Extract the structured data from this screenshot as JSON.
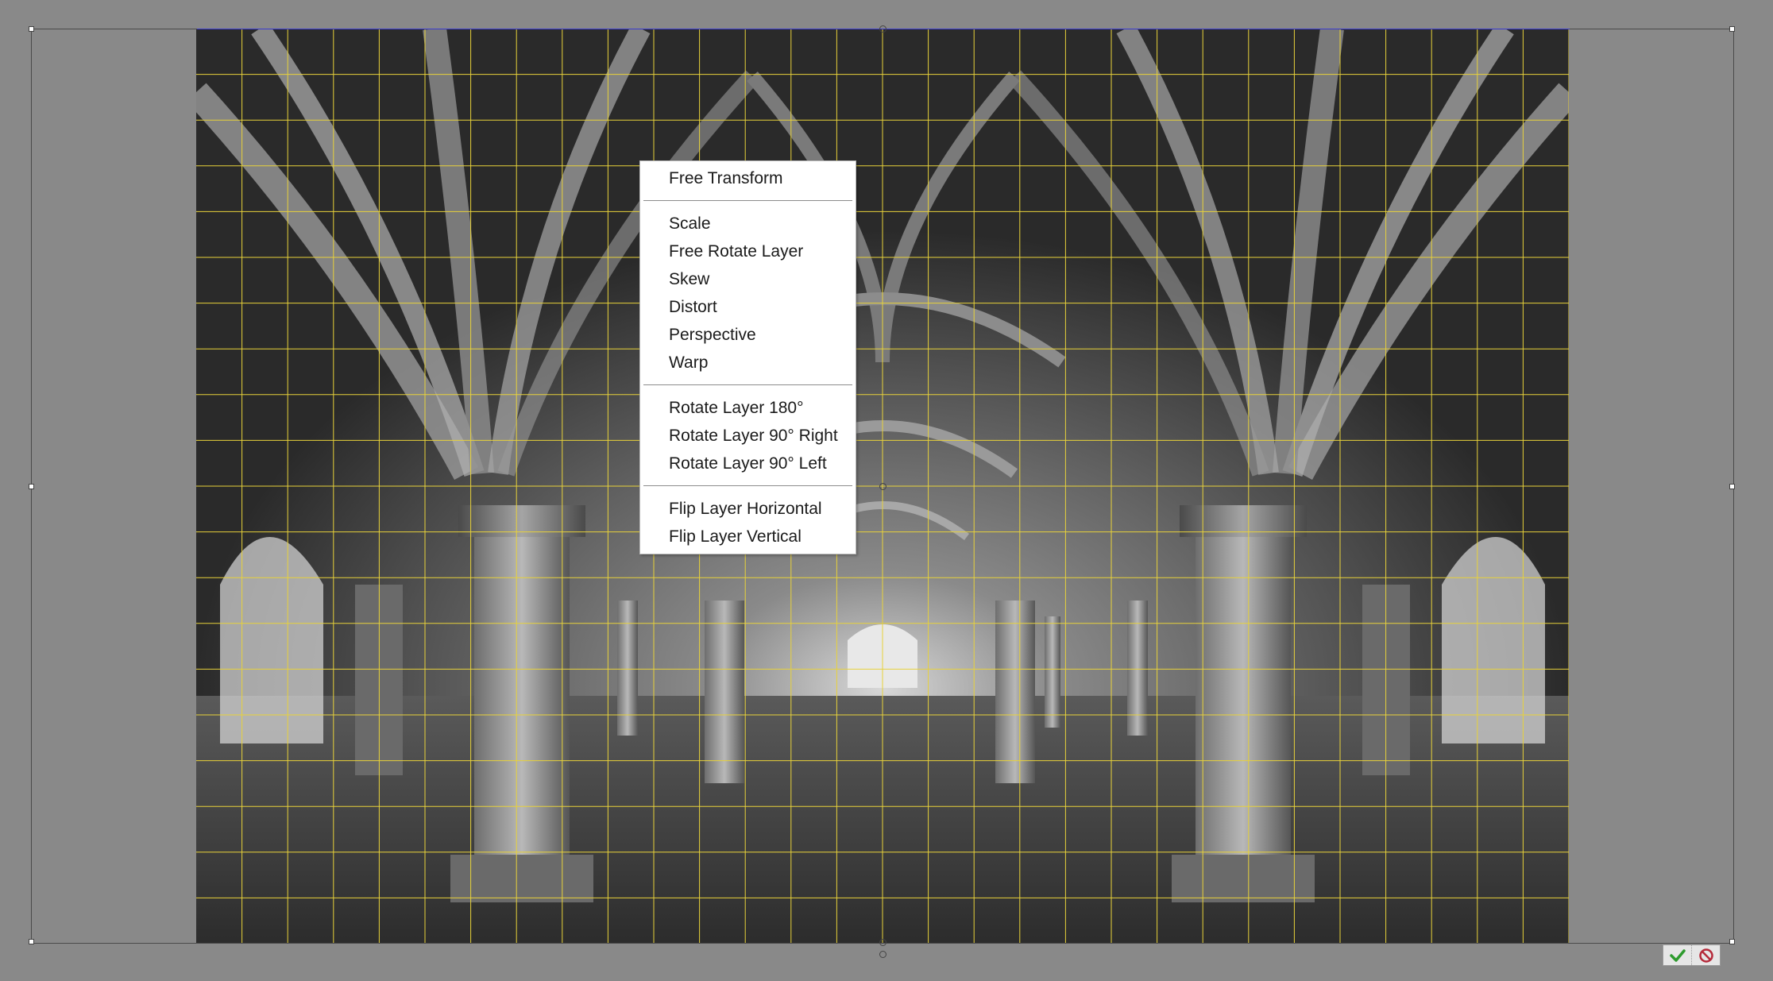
{
  "context_menu": {
    "groups": [
      [
        "Free Transform"
      ],
      [
        "Scale",
        "Free Rotate Layer",
        "Skew",
        "Distort",
        "Perspective",
        "Warp"
      ],
      [
        "Rotate Layer 180°",
        "Rotate Layer 90° Right",
        "Rotate Layer 90° Left"
      ],
      [
        "Flip Layer Horizontal",
        "Flip Layer Vertical"
      ]
    ]
  },
  "transform_controls": {
    "commit_icon": "checkmark-icon",
    "cancel_icon": "cancel-icon"
  },
  "colors": {
    "canvas_background": "#898989",
    "grid_line": "#e8d23a",
    "commit_green": "#2e9b2e",
    "cancel_red": "#b52a3a"
  }
}
